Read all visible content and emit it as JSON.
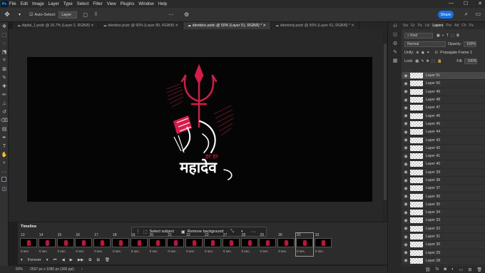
{
  "menu": [
    "File",
    "Edit",
    "Image",
    "Layer",
    "Type",
    "Select",
    "Filter",
    "View",
    "Plugins",
    "Window",
    "Help"
  ],
  "app_logo": "Ps",
  "options": {
    "auto_select_label": "Auto-Select:",
    "auto_select_value": "Layer"
  },
  "share_label": "Share",
  "tabs": [
    {
      "label": "digital_1.psdc @ 16.7% (Layer 2, RGB/8)",
      "active": false
    },
    {
      "label": "identtoo.psdc @ 50% (Layer 80, RGB/8)",
      "active": false
    },
    {
      "label": "identdoc.psdc @ 50% (Layer 51, RGB/8) *",
      "active": true
    },
    {
      "label": "identonly.psdc @ 50% (Layer 61, RGB/8) *",
      "active": false
    }
  ],
  "artwork": {
    "small_text": "हर हर",
    "main_text": "महादेव",
    "accent_color": "#d81b4a"
  },
  "timeline": {
    "title": "Timeline",
    "context_bar": {
      "select_subject": "Select subject",
      "remove_background": "Remove background"
    },
    "frames": [
      {
        "num": "13",
        "delay": "0 sec."
      },
      {
        "num": "14",
        "delay": "0 sec."
      },
      {
        "num": "15",
        "delay": "0 sec."
      },
      {
        "num": "16",
        "delay": "0 sec."
      },
      {
        "num": "17",
        "delay": "0 sec."
      },
      {
        "num": "18",
        "delay": "0 sec."
      },
      {
        "num": "19",
        "delay": "0 sec."
      },
      {
        "num": "20",
        "delay": "0 sec."
      },
      {
        "num": "21",
        "delay": "0 sec."
      },
      {
        "num": "22",
        "delay": "0 sec."
      },
      {
        "num": "23",
        "delay": "0 sec."
      },
      {
        "num": "27",
        "delay": "0 sec."
      },
      {
        "num": "28",
        "delay": "0 sec."
      },
      {
        "num": "29",
        "delay": "0 sec."
      },
      {
        "num": "30",
        "delay": "0 sec."
      },
      {
        "num": "31",
        "delay": "0 sec.",
        "selected": true
      },
      {
        "num": "32",
        "delay": "0 sec."
      }
    ],
    "loop": "Forever"
  },
  "status": {
    "zoom": "50%",
    "doc_size": "2567 px x 1080 px (300 ppi)"
  },
  "layers_panel": {
    "tabs": [
      "Sw",
      "Gr",
      "Pa",
      "Lib",
      "Layers",
      "Pro",
      "Ad",
      "Ch",
      "Pa"
    ],
    "active_tab": "Layers",
    "kind": "Kind",
    "blend_mode": "Normal",
    "opacity_label": "Opacity:",
    "opacity": "100%",
    "unify_label": "Unify:",
    "propagate": "Propagate Frame 1",
    "lock_label": "Lock:",
    "fill_label": "Fill:",
    "fill": "100%",
    "layers": [
      "Layer 51",
      "Layer 50",
      "Layer 49",
      "Layer 48",
      "Layer 47",
      "Layer 46",
      "Layer 45",
      "Layer 44",
      "Layer 43",
      "Layer 42",
      "Layer 41",
      "Layer 40",
      "Layer 39",
      "Layer 38",
      "Layer 37",
      "Layer 36",
      "Layer 35",
      "Layer 34",
      "Layer 33",
      "Layer 32",
      "Layer 31",
      "Layer 30",
      "Layer 29",
      "Layer 28"
    ],
    "selected_layer": "Layer 51"
  }
}
